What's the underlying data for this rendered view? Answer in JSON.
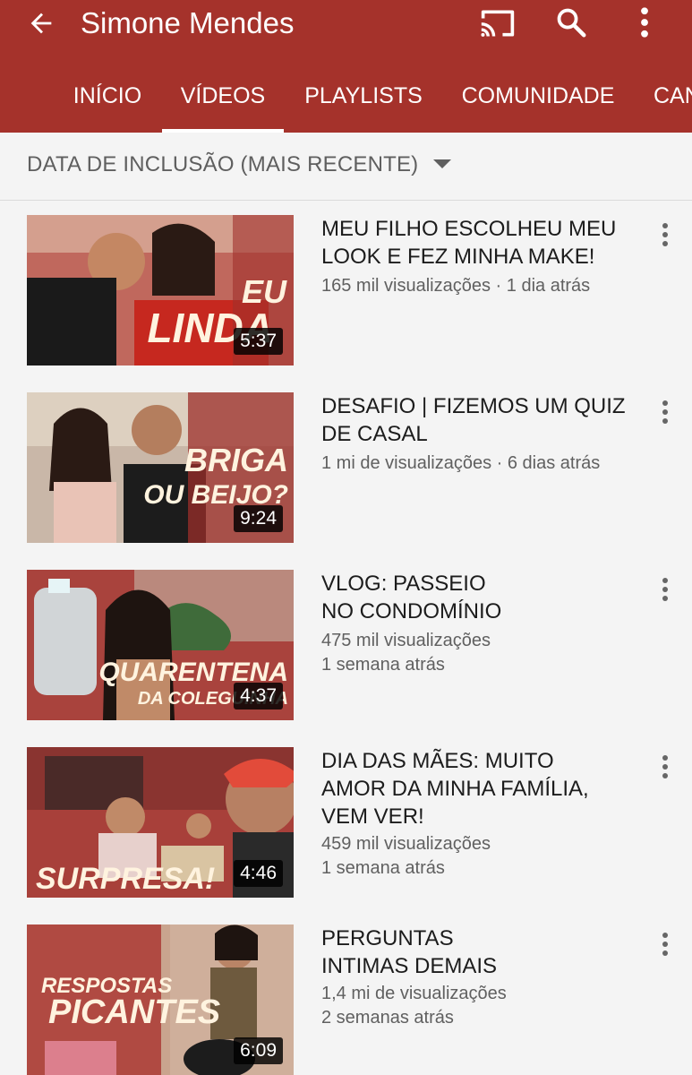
{
  "header": {
    "title": "Simone Mendes",
    "back_icon": "arrow-back-icon",
    "cast_icon": "cast-icon",
    "search_icon": "search-icon",
    "menu_icon": "more-vert-icon",
    "color": "#a5322b"
  },
  "tabs": [
    {
      "label": "INÍCIO",
      "active": false
    },
    {
      "label": "VÍDEOS",
      "active": true
    },
    {
      "label": "PLAYLISTS",
      "active": false
    },
    {
      "label": "COMUNIDADE",
      "active": false
    },
    {
      "label": "CANAIS",
      "active": false
    }
  ],
  "sort": {
    "label": "DATA DE INCLUSÃO (MAIS RECENTE)",
    "icon": "dropdown-arrow-icon"
  },
  "videos": [
    {
      "title_line1": "MEU FILHO ESCOLHEU MEU",
      "title_line2": "LOOK E FEZ MINHA MAKE!",
      "title_line3": "",
      "views": "165 mil visualizações",
      "age": "1 dia atrás",
      "meta_sep": " · ",
      "duration": "5:37",
      "thumb_text1": "EU",
      "thumb_text2": "LINDA"
    },
    {
      "title_line1": "DESAFIO | FIZEMOS UM QUIZ",
      "title_line2": "DE CASAL",
      "title_line3": "",
      "views": "1 mi de visualizações",
      "age": "6 dias atrás",
      "meta_sep": " · ",
      "duration": "9:24",
      "thumb_text1": "BRIGA",
      "thumb_text2": "OU BEIJO?"
    },
    {
      "title_line1": "VLOG: PASSEIO",
      "title_line2": "NO CONDOMÍNIO",
      "title_line3": "",
      "views": "475 mil visualizações",
      "age": "1 semana atrás",
      "duration": "4:37",
      "thumb_text1": "QUARENTENA",
      "thumb_text2": "DA COLEGUINHA"
    },
    {
      "title_line1": "DIA DAS MÃES: MUITO",
      "title_line2": "AMOR DA MINHA FAMÍLIA,",
      "title_line3": "VEM VER!",
      "views": "459 mil visualizações",
      "age": "1 semana atrás",
      "duration": "4:46",
      "thumb_text1": "SURPRESA!",
      "thumb_text2": ""
    },
    {
      "title_line1": "PERGUNTAS",
      "title_line2": "INTIMAS DEMAIS",
      "title_line3": "",
      "views": "1,4 mi de visualizações",
      "age": "2 semanas atrás",
      "duration": "6:09",
      "thumb_text1": "RESPOSTAS",
      "thumb_text2": "PICANTES"
    }
  ]
}
